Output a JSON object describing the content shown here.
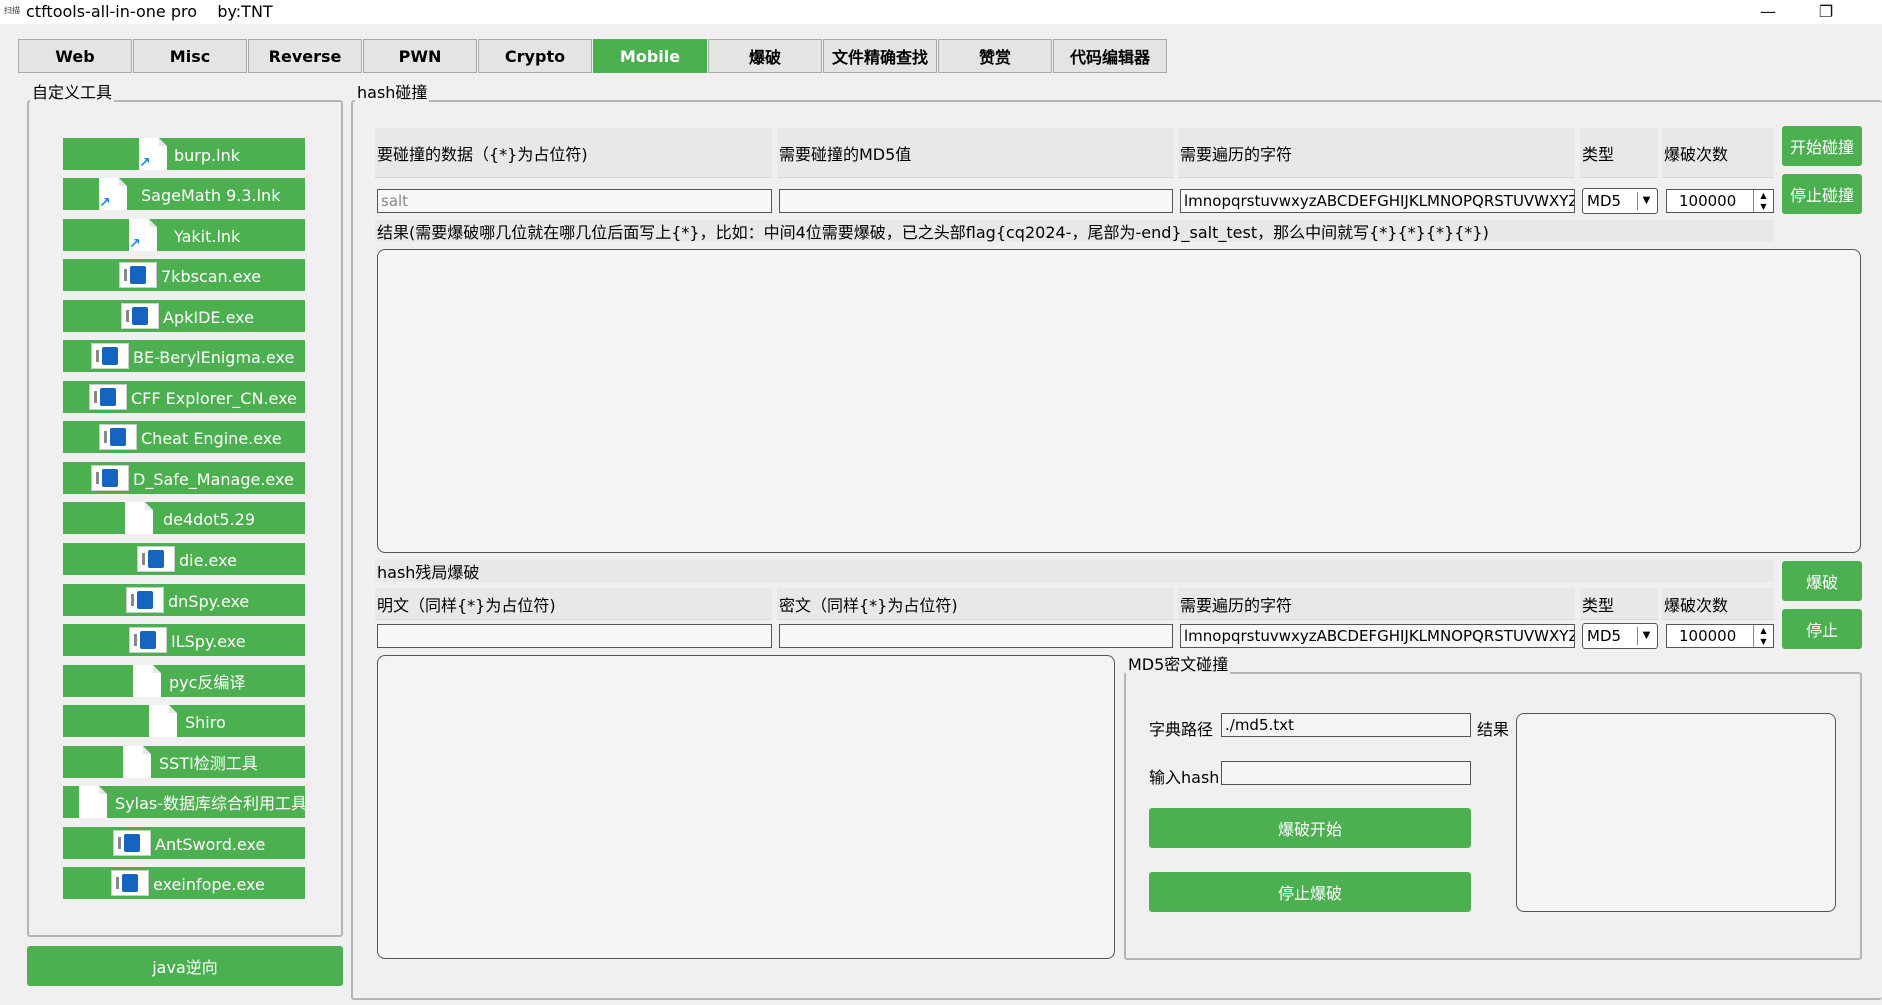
{
  "window": {
    "app_icon": "扫描",
    "title": "ctftools-all-in-one pro    by:TNT",
    "minimize": "—",
    "maximize": "❐",
    "close": "✕"
  },
  "tabs": [
    {
      "label": "Web"
    },
    {
      "label": "Misc"
    },
    {
      "label": "Reverse"
    },
    {
      "label": "PWN"
    },
    {
      "label": "Crypto"
    },
    {
      "label": "Mobile"
    },
    {
      "label": "爆破"
    },
    {
      "label": "文件精确查找"
    },
    {
      "label": "赞赏"
    },
    {
      "label": "代码编辑器"
    }
  ],
  "active_tab": "Mobile",
  "sidebar": {
    "title": "自定义工具",
    "tools": [
      {
        "label": "burp.lnk",
        "icon": "shortcut-icon"
      },
      {
        "label": "SageMath 9.3.lnk",
        "icon": "shortcut-icon"
      },
      {
        "label": "Yakit.lnk",
        "icon": "shortcut-icon"
      },
      {
        "label": "7kbscan.exe",
        "icon": "exe-icon"
      },
      {
        "label": "ApkIDE.exe",
        "icon": "exe-icon"
      },
      {
        "label": "BE-BerylEnigma.exe",
        "icon": "exe-icon"
      },
      {
        "label": "CFF Explorer_CN.exe",
        "icon": "exe-icon"
      },
      {
        "label": "Cheat Engine.exe",
        "icon": "exe-icon"
      },
      {
        "label": "D_Safe_Manage.exe",
        "icon": "exe-icon"
      },
      {
        "label": "de4dot5.29",
        "icon": "file-icon"
      },
      {
        "label": "die.exe",
        "icon": "exe-icon"
      },
      {
        "label": "dnSpy.exe",
        "icon": "exe-icon"
      },
      {
        "label": "ILSpy.exe",
        "icon": "exe-icon"
      },
      {
        "label": "pyc反编译",
        "icon": "file-icon"
      },
      {
        "label": "Shiro",
        "icon": "file-icon"
      },
      {
        "label": "SSTI检测工具",
        "icon": "file-icon"
      },
      {
        "label": "Sylas-数据库综合利用工具",
        "icon": "file-icon"
      },
      {
        "label": "AntSword.exe",
        "icon": "exe-icon"
      },
      {
        "label": "exeinfope.exe",
        "icon": "exe-icon"
      }
    ],
    "bottom_button": "java逆向"
  },
  "hash_collision": {
    "title": "hash碰撞",
    "headers": {
      "data": "要碰撞的数据（{*}为占位符)",
      "md5": "需要碰撞的MD5值",
      "chars": "需要遍历的字符",
      "type": "类型",
      "count": "爆破次数"
    },
    "data_value": "salt",
    "md5_value": "",
    "chars_value": "lmnopqrstuvwxyzABCDEFGHIJKLMNOPQRSTUVWXYZ",
    "type_value": "MD5",
    "count_value": "100000",
    "start_button": "开始碰撞",
    "stop_button": "停止碰撞",
    "result_label": "结果(需要爆破哪几位就在哪几位后面写上{*}，比如：中间4位需要爆破，已之头部flag{cq2024-，尾部为-end}_salt_test，那么中间就写{*}{*}{*}{*})"
  },
  "hash_partial": {
    "title": "hash残局爆破",
    "headers": {
      "plain": "明文（同样{*}为占位符)",
      "cipher": "密文（同样{*}为占位符)",
      "chars": "需要遍历的字符",
      "type": "类型",
      "count": "爆破次数"
    },
    "plain_value": "",
    "cipher_value": "",
    "chars_value": "lmnopqrstuvwxyzABCDEFGHIJKLMNOPQRSTUVWXYZ",
    "type_value": "MD5",
    "count_value": "100000",
    "brute_button": "爆破",
    "stop_button": "停止"
  },
  "md5_collision": {
    "title": "MD5密文碰撞",
    "dict_label": "字典路径",
    "dict_value": "./md5.txt",
    "hash_label": "输入hash",
    "hash_value": "",
    "result_label": "结果",
    "start_button": "爆破开始",
    "stop_button": "停止爆破"
  }
}
